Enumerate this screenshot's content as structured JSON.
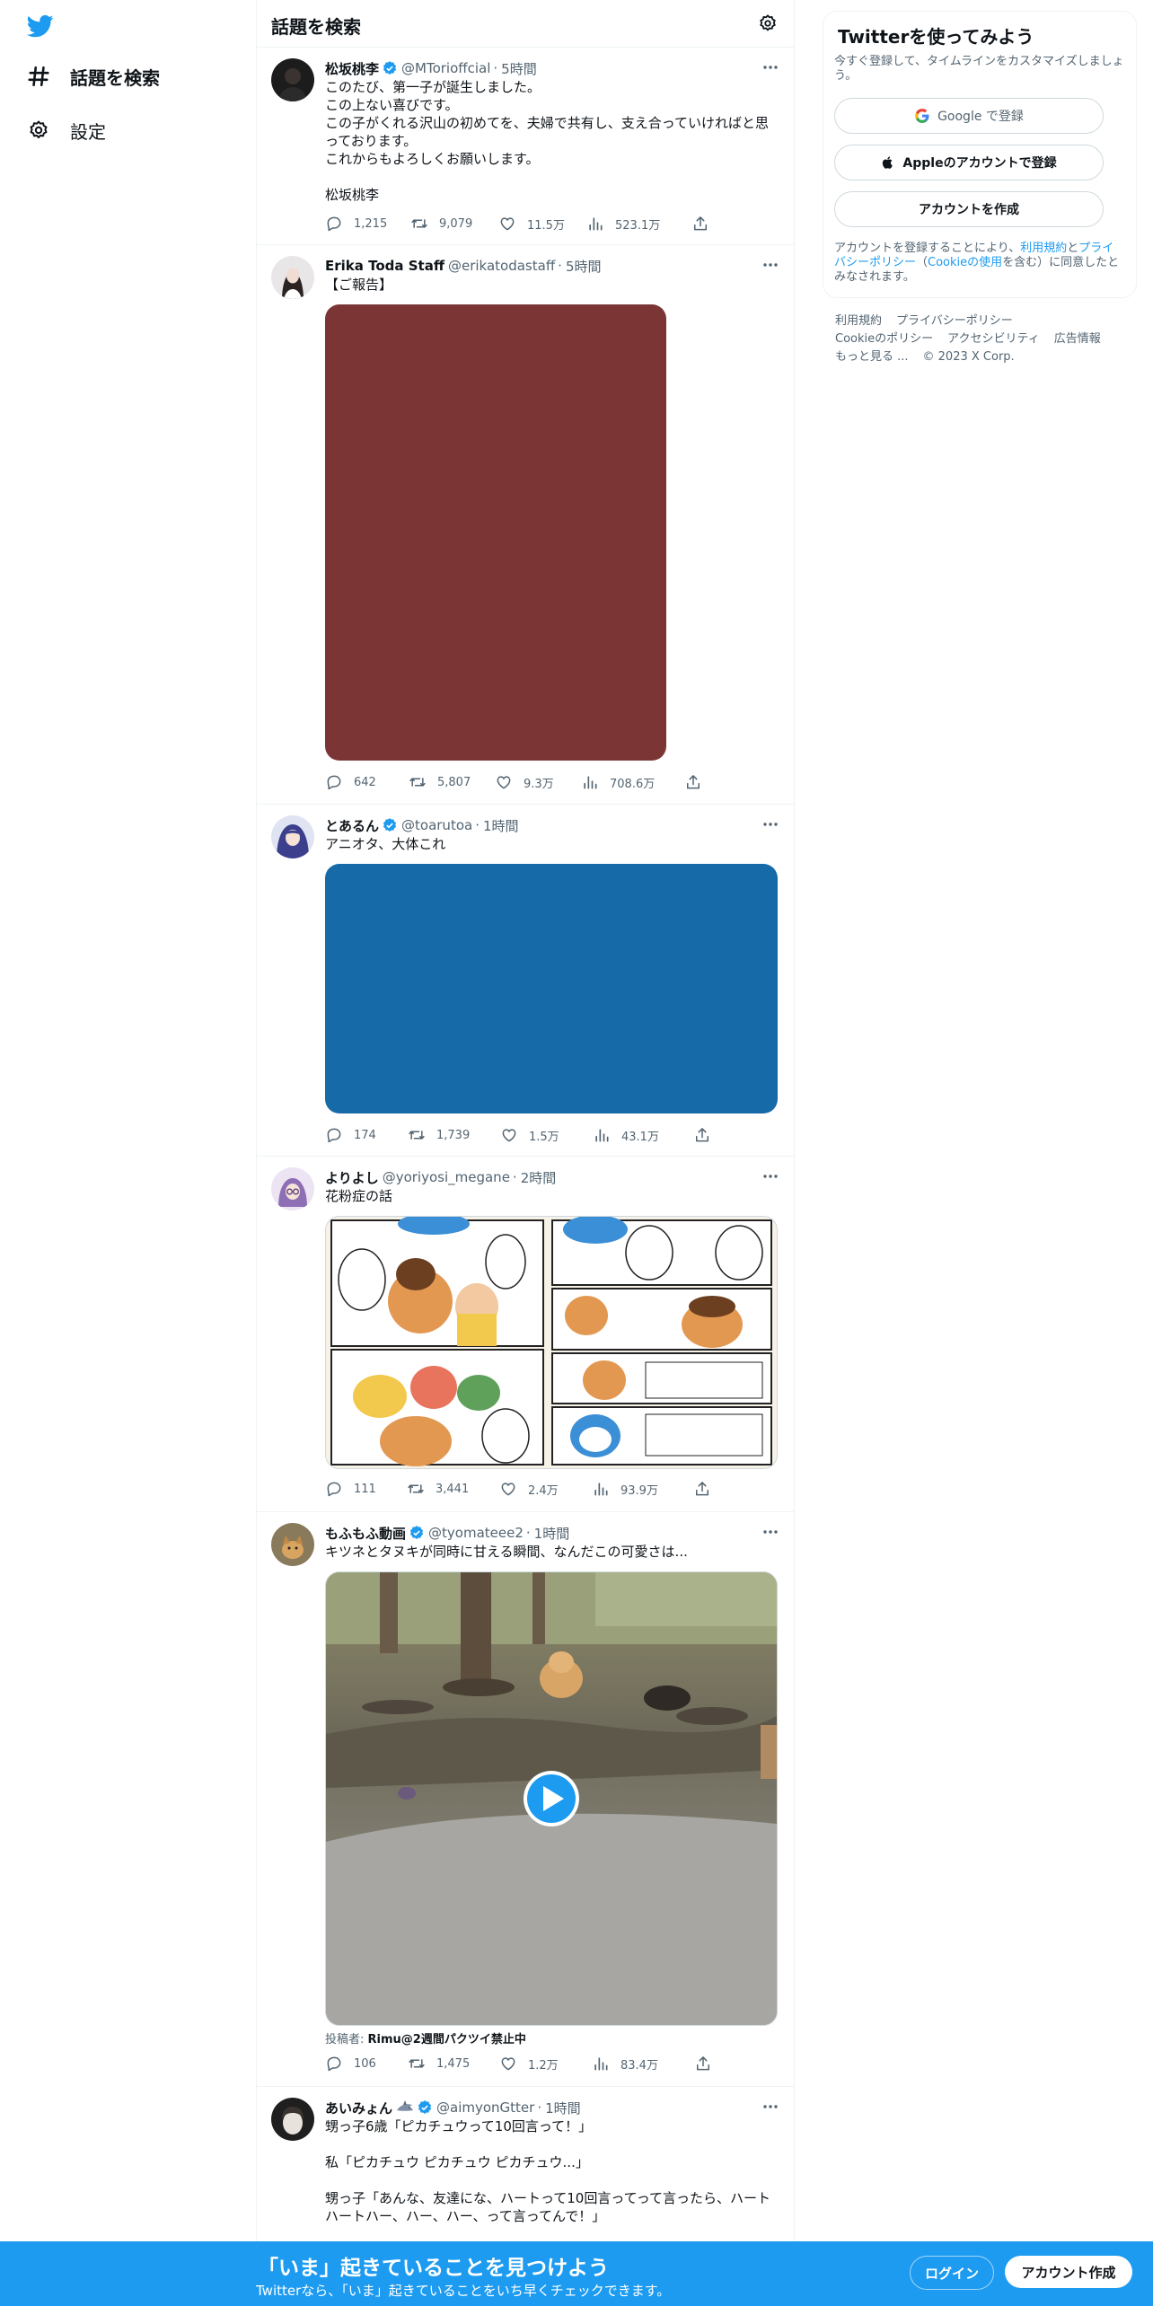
{
  "nav": {
    "items": [
      {
        "label": "話題を検索",
        "icon": "hashtag-icon"
      },
      {
        "label": "設定",
        "icon": "gear-icon"
      }
    ]
  },
  "header": {
    "title": "話題を検索"
  },
  "tweets": [
    {
      "name": "松坂桃李",
      "verified": true,
      "handle": "@MTorioffcial",
      "time": "5時間",
      "text": [
        "このたび、第一子が誕生しました。",
        "この上ない喜びです。",
        "この子がくれる沢山の初めてを、夫婦で共有し、支え合っていければと思",
        "っております。",
        "これからもよろしくお願いします。",
        "",
        "松坂桃李"
      ],
      "replies": "1,215",
      "retweets": "9,079",
      "likes": "11.5万",
      "views": "523.1万"
    },
    {
      "name": "Erika Toda Staff",
      "verified": false,
      "handle": "@erikatodastaff",
      "time": "5時間",
      "text": [
        "【ご報告】"
      ],
      "media_color": "#7b3535",
      "replies": "642",
      "retweets": "5,807",
      "likes": "9.3万",
      "views": "708.6万"
    },
    {
      "name": "とあるん",
      "verified": true,
      "handle": "@toarutoa",
      "time": "1時間",
      "text": [
        "アニオタ、大体これ"
      ],
      "media_color": "#166aa8",
      "replies": "174",
      "retweets": "1,739",
      "likes": "1.5万",
      "views": "43.1万"
    },
    {
      "name": "よりよし",
      "verified": false,
      "handle": "@yoriyosi_megane",
      "time": "2時間",
      "text": [
        "花粉症の話"
      ],
      "replies": "111",
      "retweets": "3,441",
      "likes": "2.4万",
      "views": "93.9万"
    },
    {
      "name": "もふもふ動画",
      "verified": true,
      "handle": "@tyomateee2",
      "time": "1時間",
      "text": [
        "キツネとタヌキが同時に甘える瞬間、なんだこの可愛さは..."
      ],
      "byline_prefix": "投稿者:",
      "byline_name": "Rimu@2週間パクツイ禁止中",
      "replies": "106",
      "retweets": "1,475",
      "likes": "1.2万",
      "views": "83.4万"
    },
    {
      "name": "あいみょん",
      "verified": true,
      "handle": "@aimyonGtter",
      "time": "1時間",
      "text": [
        "甥っ子6歳「ピカチュウって10回言って！」",
        "",
        "私「ピカチュウ ピカチュウ ピカチュウ...」",
        "",
        "甥っ子「あんな、友達にな、ハートって10回言ってって言ったら、ハート",
        "ハートハー、ハー、ハー、って言ってんで！」"
      ]
    }
  ],
  "signup": {
    "title": "Twitterを使ってみよう",
    "subtitle": "今すぐ登録して、タイムラインをカスタマイズしましょう。",
    "google_label": "Google で登録",
    "apple_label": "Appleのアカウントで登録",
    "create_label": "アカウントを作成",
    "terms_1": "アカウントを登録することにより、",
    "terms_link_1": "利用規約",
    "terms_2": "と",
    "terms_link_2": "プライバシーポリシー",
    "terms_3": "（",
    "terms_link_3": "Cookieの使用",
    "terms_4": "を含む）に同意したとみなされます。"
  },
  "footer": {
    "links": [
      "利用規約",
      "プライバシーポリシー",
      "Cookieのポリシー",
      "アクセシビリティ",
      "広告情報",
      "もっと見る ..."
    ],
    "copyright": "© 2023 X Corp."
  },
  "bottom_bar": {
    "title": "「いま」起きていることを見つけよう",
    "subtitle": "Twitterなら、「いま」起きていることをいち早くチェックできます。",
    "login_label": "ログイン",
    "signup_label": "アカウント作成"
  },
  "colors": {
    "brand": "#1d9bf0",
    "text": "#0f1419",
    "muted": "#536471"
  }
}
